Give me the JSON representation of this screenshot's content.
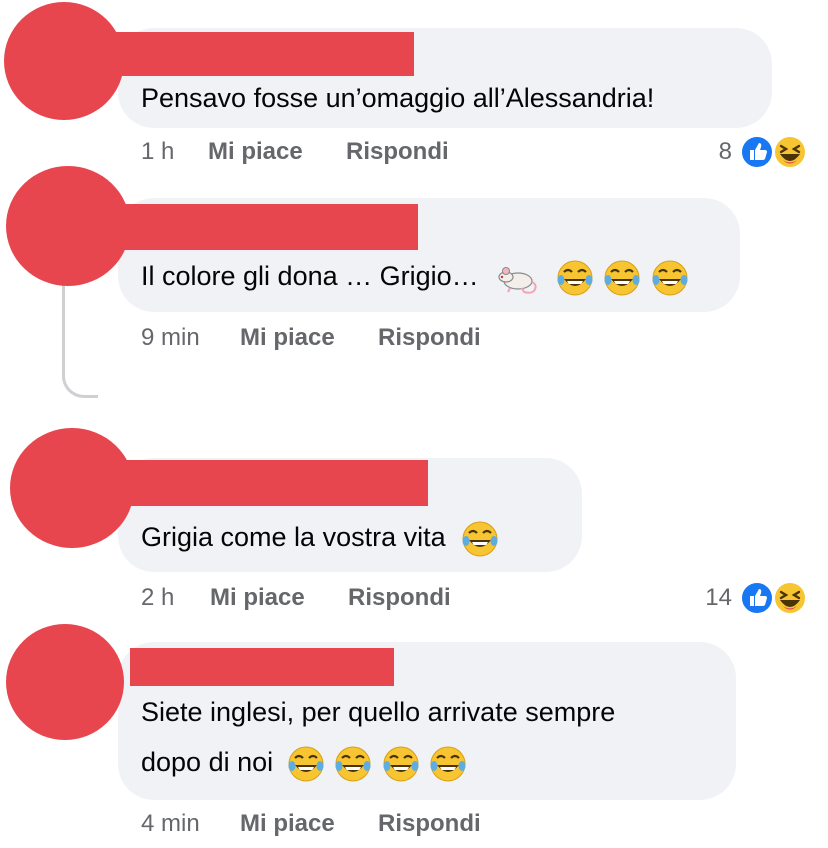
{
  "comments": [
    {
      "text": "Pensavo fosse un’omaggio all’Alessandria!",
      "time": "1 h",
      "like_label": "Mi piace",
      "reply_label": "Rispondi",
      "reaction_count": "8"
    },
    {
      "text": "Il colore gli dona … Grigio…",
      "time": "9 min",
      "like_label": "Mi piace",
      "reply_label": "Rispondi",
      "emojis": [
        "rat-emoji",
        "laughing-emoji",
        "laughing-emoji",
        "laughing-emoji"
      ]
    },
    {
      "text": "Grigia come la vostra vita",
      "time": "2 h",
      "like_label": "Mi piace",
      "reply_label": "Rispondi",
      "reaction_count": "14",
      "emojis": [
        "laughing-emoji"
      ]
    },
    {
      "text_line1": "Siete inglesi, per quello arrivate sempre",
      "text_line2": "dopo di noi",
      "time": "4 min",
      "like_label": "Mi piace",
      "reply_label": "Rispondi",
      "emojis": [
        "laughing-emoji",
        "laughing-emoji",
        "laughing-emoji",
        "laughing-emoji"
      ]
    }
  ],
  "reactions": [
    "like-icon",
    "haha-icon"
  ],
  "colors": {
    "bubble": "#f0f2f5",
    "meta_text": "#65676b",
    "redaction": "#e8464e",
    "like_blue": "#1877f2",
    "haha_yellow": "#f7c531"
  }
}
